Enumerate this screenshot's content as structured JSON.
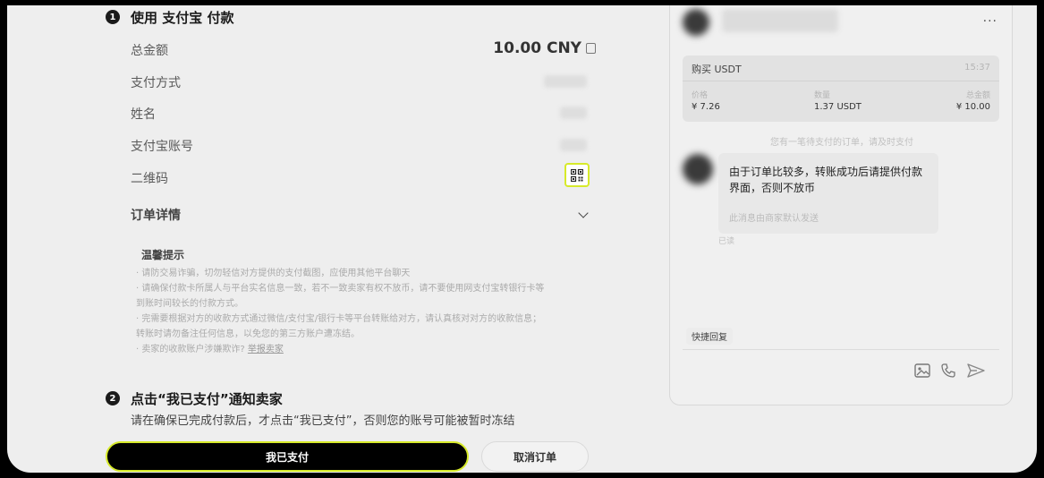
{
  "step1": {
    "num": "1",
    "title": "使用 支付宝 付款"
  },
  "details": {
    "total_label": "总金额",
    "total_value": "10.00 CNY",
    "method_label": "支付方式",
    "name_label": "姓名",
    "account_label": "支付宝账号",
    "qr_label": "二维码",
    "order_detail_label": "订单详情"
  },
  "tips": {
    "title": "温馨提示",
    "lines": [
      "· 请防交易诈骗，切勿轻信对方提供的支付截图，应使用其他平台聊天",
      "· 请确保付款卡所属人与平台实名信息一致，若不一致卖家有权不放币，请不要使用网支付宝转银行卡等",
      "  到账时间较长的付款方式。",
      "· 完需要根据对方的收款方式通过微信/支付宝/银行卡等平台转账给对方，请认真核对对方的收款信息；",
      "  转账时请勿备注任何信息，以免您的第三方账户遭冻结。"
    ],
    "last_line": "· 卖家的收款账户涉嫌欺诈?",
    "last_link": "举报卖家"
  },
  "step2": {
    "num": "2",
    "title": "点击“我已支付”通知卖家",
    "subtitle": "请在确保已完成付款后，才点击“我已支付”，否则您的账号可能被暂时冻结"
  },
  "buttons": {
    "paid": "我已支付",
    "cancel": "取消订单"
  },
  "chat": {
    "more": "...",
    "card": {
      "title": "购买 USDT",
      "time": "15:37",
      "cols": [
        {
          "label": "价格",
          "value": "¥ 7.26"
        },
        {
          "label": "数量",
          "value": "1.37 USDT"
        },
        {
          "label": "总金额",
          "value": "¥ 10.00"
        }
      ]
    },
    "system_note": "您有一笔待支付的订单，请及时支付",
    "message": "由于订单比较多，转账成功后请提供付款界面，否则不放币",
    "message_sub": "此消息由商家默认发送",
    "read": "已读",
    "quick_reply": "快捷回复"
  }
}
